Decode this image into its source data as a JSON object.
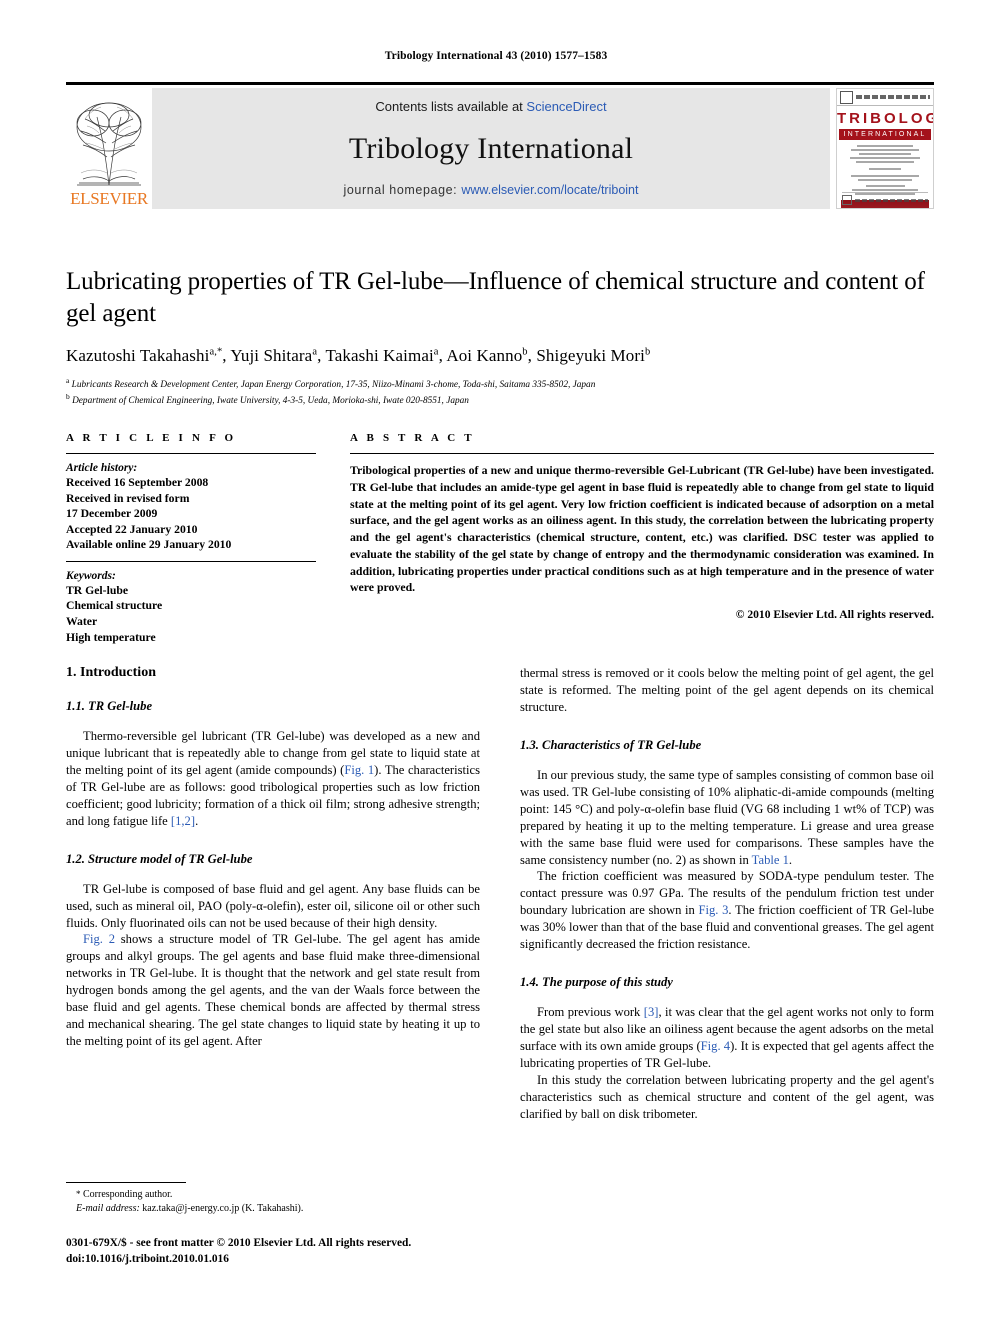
{
  "running_head": "Tribology International 43 (2010) 1577–1583",
  "masthead": {
    "contents_prefix": "Contents lists available at ",
    "contents_link": "ScienceDirect",
    "journal_name": "Tribology International",
    "homepage_prefix": "journal homepage: ",
    "homepage_link": "www.elsevier.com/locate/triboint",
    "publisher_name": "ELSEVIER",
    "cover": {
      "title": "TRIBOLOGY",
      "subtitle": "INTERNATIONAL"
    }
  },
  "article": {
    "title": "Lubricating properties of TR Gel-lube—Influence of chemical structure and content of gel agent",
    "authors": "Kazutoshi Takahashi a,*, Yuji Shitara a, Takashi Kaimai a, Aoi Kanno b, Shigeyuki Mori b",
    "affiliations": [
      "a Lubricants Research & Development Center, Japan Energy Corporation, 17-35, Niizo-Minami 3-chome, Toda-shi, Saitama 335-8502, Japan",
      "b Department of Chemical Engineering, Iwate University, 4-3-5, Ueda, Morioka-shi, Iwate 020-8551, Japan"
    ]
  },
  "article_info": {
    "heading": "A R T I C L E  I N F O",
    "history_label": "Article history:",
    "history_lines": [
      "Received 16 September 2008",
      "Received in revised form",
      "17 December 2009",
      "Accepted 22 January 2010",
      "Available online 29 January 2010"
    ],
    "keywords_label": "Keywords:",
    "keywords": [
      "TR Gel-lube",
      "Chemical structure",
      "Water",
      "High temperature"
    ]
  },
  "abstract": {
    "heading": "A B S T R A C T",
    "text": "Tribological properties of a new and unique thermo-reversible Gel-Lubricant (TR Gel-lube) have been investigated. TR Gel-lube that includes an amide-type gel agent in base fluid is repeatedly able to change from gel state to liquid state at the melting point of its gel agent. Very low friction coefficient is indicated because of adsorption on a metal surface, and the gel agent works as an oiliness agent. In this study, the correlation between the lubricating property and the gel agent's characteristics (chemical structure, content, etc.) was clarified. DSC tester was applied to evaluate the stability of the gel state by change of entropy and the thermodynamic consideration was examined. In addition, lubricating properties under practical conditions such as at high temperature and in the presence of water were proved.",
    "copyright": "© 2010 Elsevier Ltd. All rights reserved."
  },
  "body": {
    "left": {
      "section_heading": "1.  Introduction",
      "sub1_heading": "1.1.  TR Gel-lube",
      "sub1_p1_a": "Thermo-reversible gel lubricant (TR Gel-lube) was developed as a new and unique lubricant that is repeatedly able to change from gel state to liquid state at the melting point of its gel agent (amide compounds) (",
      "sub1_p1_link1": "Fig. 1",
      "sub1_p1_b": "). The characteristics of TR Gel-lube are as follows: good tribological properties such as low friction coefficient; good lubricity; formation of a thick oil film; strong adhesive strength; and long fatigue life ",
      "sub1_p1_link2": "[1,2]",
      "sub1_p1_c": ".",
      "sub2_heading": "1.2.  Structure model of TR Gel-lube",
      "sub2_p1": "TR Gel-lube is composed of base fluid and gel agent. Any base fluids can be used, such as mineral oil, PAO (poly-α-olefin), ester oil, silicone oil or other such fluids. Only fluorinated oils can not be used because of their high density.",
      "sub2_p2_link": "Fig. 2",
      "sub2_p2_text": " shows a structure model of TR Gel-lube. The gel agent has amide groups and alkyl groups. The gel agents and base fluid make three-dimensional networks in TR Gel-lube. It is thought that the network and gel state result from hydrogen bonds among the gel agents, and the van der Waals force between the base fluid and gel agents. These chemical bonds are affected by thermal stress and mechanical shearing. The gel state changes to liquid state by heating it up to the melting point of its gel agent. After"
    },
    "right": {
      "cont_p": "thermal stress is removed or it cools below the melting point of gel agent, the gel state is reformed. The melting point of the gel agent depends on its chemical structure.",
      "sub3_heading": "1.3.  Characteristics of TR Gel-lube",
      "sub3_p1_a": "In our previous study, the same type of samples consisting of common base oil was used. TR Gel-lube consisting of 10% aliphatic-di-amide compounds (melting point: 145 °C) and poly-α-olefin base fluid (VG 68 including 1 wt% of TCP) was prepared by heating it up to the melting temperature. Li grease and urea grease with the same base fluid were used for comparisons. These samples have the same consistency number (no. 2) as shown in ",
      "sub3_p1_link": "Table 1",
      "sub3_p1_b": ".",
      "sub3_p2_a": "The friction coefficient was measured by SODA-type pendulum tester. The contact pressure was 0.97 GPa. The results of the pendulum friction test under boundary lubrication are shown in ",
      "sub3_p2_link": "Fig. 3",
      "sub3_p2_b": ". The friction coefficient of TR Gel-lube was 30% lower than that of the base fluid and conventional greases. The gel agent significantly decreased the friction resistance.",
      "sub4_heading": "1.4.  The purpose of this study",
      "sub4_p1_a": "From previous work ",
      "sub4_p1_link1": "[3]",
      "sub4_p1_b": ", it was clear that the gel agent works not only to form the gel state but also like an oiliness agent because the agent adsorbs on the metal surface with its own amide groups (",
      "sub4_p1_link2": "Fig. 4",
      "sub4_p1_c": "). It is expected that gel agents affect the lubricating properties of TR Gel-lube.",
      "sub4_p2": "In this study the correlation between lubricating property and the gel agent's characteristics such as chemical structure and content of the gel agent, was clarified by ball on disk tribometer."
    }
  },
  "footer": {
    "corresponding_star": "*",
    "corresponding_text": " Corresponding author.",
    "email_label": "E-mail address:",
    "email_value": " kaz.taka@j-energy.co.jp (K. Takahashi).",
    "imprint_line1": "0301-679X/$ - see front matter © 2010 Elsevier Ltd. All rights reserved.",
    "imprint_line2": "doi:10.1016/j.triboint.2010.01.016"
  }
}
